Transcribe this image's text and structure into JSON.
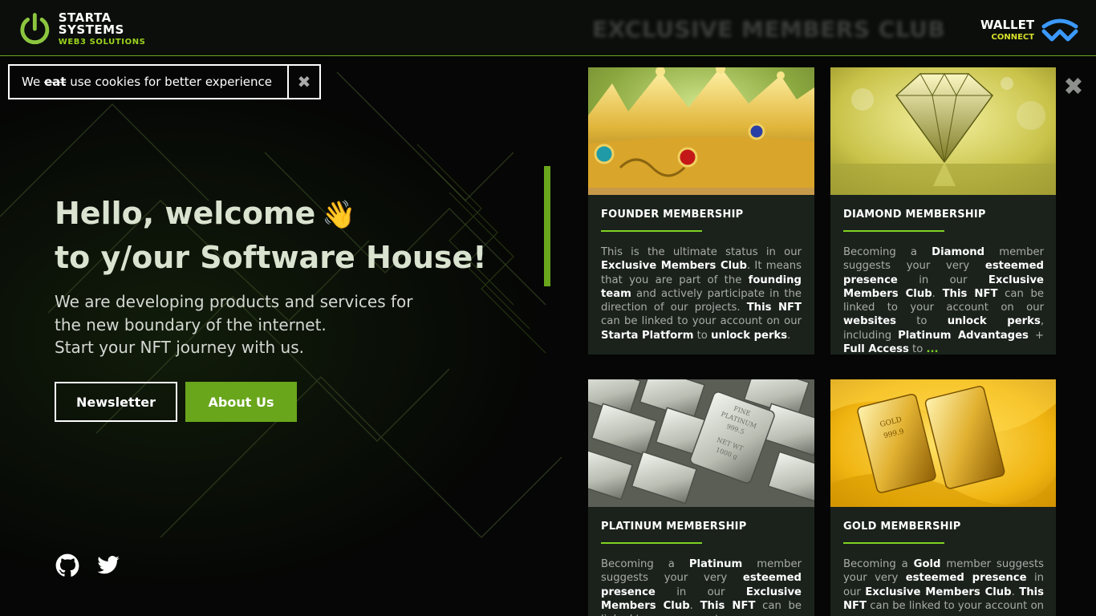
{
  "header": {
    "logo_title": "STARTA SYSTEMS",
    "logo_subtitle": "WEB3 SOLUTIONS",
    "blurred_title": "EXCLUSIVE MEMBERS CLUB",
    "wallet_title": "WALLET",
    "wallet_subtitle": "CONNECT"
  },
  "cookie": {
    "prefix": "We ",
    "struck": "eat",
    "suffix": " use cookies for better experience",
    "close_label": "✖"
  },
  "hero": {
    "title_line1": "Hello, welcome",
    "wave_emoji": "👋",
    "title_line2": "to y/our Software House!",
    "subtitle_line1": "We are developing products and services for",
    "subtitle_line2": "the new boundary of the internet.",
    "subtitle_line3": "Start your NFT journey with us.",
    "newsletter_label": "Newsletter",
    "about_label": "About Us"
  },
  "social": {
    "github_icon": "github-icon",
    "twitter_icon": "twitter-icon"
  },
  "panel": {
    "close_label": "✖"
  },
  "cards": [
    {
      "title": "FOUNDER MEMBERSHIP",
      "image": "crown",
      "body": [
        {
          "t": "This is the ultimate status in our "
        },
        {
          "t": "Exclusive Members Club",
          "b": true
        },
        {
          "t": ". It means that you are part of the "
        },
        {
          "t": "founding team",
          "b": true
        },
        {
          "t": " and actively participate in the direction of our projects. "
        },
        {
          "t": "This NFT",
          "b": true
        },
        {
          "t": " can be linked to your account on our "
        },
        {
          "t": "Starta Platform",
          "b": true
        },
        {
          "t": " to "
        },
        {
          "t": "unlock perks",
          "b": true
        },
        {
          "t": "."
        }
      ]
    },
    {
      "title": "DIAMOND MEMBERSHIP",
      "image": "diamond",
      "body": [
        {
          "t": "Becoming a "
        },
        {
          "t": "Diamond",
          "b": true
        },
        {
          "t": " member suggests your very "
        },
        {
          "t": "esteemed presence",
          "b": true
        },
        {
          "t": " in our "
        },
        {
          "t": "Exclusive Members Club",
          "b": true
        },
        {
          "t": ". "
        },
        {
          "t": "This NFT",
          "b": true
        },
        {
          "t": " can be linked to your account on our "
        },
        {
          "t": "websites",
          "b": true
        },
        {
          "t": " to "
        },
        {
          "t": "unlock perks",
          "b": true
        },
        {
          "t": ", including "
        },
        {
          "t": "Platinum Advantages",
          "b": true
        },
        {
          "t": " + "
        },
        {
          "t": "Full Access",
          "b": true
        },
        {
          "t": " to "
        },
        {
          "t": "...",
          "more": true
        }
      ]
    },
    {
      "title": "PLATINUM MEMBERSHIP",
      "image": "platinum",
      "bar_text": [
        "FINE",
        "PLATINUM",
        "999.5",
        "NET WT",
        "1000 g"
      ],
      "body": [
        {
          "t": "Becoming a "
        },
        {
          "t": "Platinum",
          "b": true
        },
        {
          "t": " member suggests your very "
        },
        {
          "t": "esteemed presence",
          "b": true
        },
        {
          "t": " in our "
        },
        {
          "t": "Exclusive Members Club",
          "b": true
        },
        {
          "t": ". "
        },
        {
          "t": "This NFT",
          "b": true
        },
        {
          "t": " can be linked to your account on our"
        }
      ]
    },
    {
      "title": "GOLD MEMBERSHIP",
      "image": "gold",
      "bar_text": [
        "GOLD",
        "999.9"
      ],
      "body": [
        {
          "t": "Becoming a "
        },
        {
          "t": "Gold",
          "b": true
        },
        {
          "t": " member suggests your very "
        },
        {
          "t": "esteemed presence",
          "b": true
        },
        {
          "t": " in our "
        },
        {
          "t": "Exclusive Members Club",
          "b": true
        },
        {
          "t": ". "
        },
        {
          "t": "This NFT",
          "b": true
        },
        {
          "t": " can be linked to your account on our"
        }
      ]
    }
  ],
  "colors": {
    "accent_green": "#69a61c",
    "line_green": "#7ed321",
    "wallet_blue": "#3b99fc",
    "card_bg": "#1b221c"
  }
}
